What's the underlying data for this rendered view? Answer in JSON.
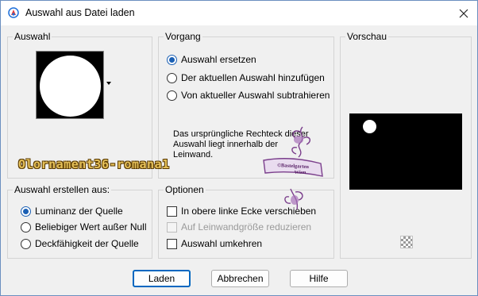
{
  "window": {
    "title": "Auswahl aus Datei laden"
  },
  "groups": {
    "auswahl": {
      "title": "Auswahl"
    },
    "vorgang": {
      "title": "Vorgang",
      "options": [
        {
          "label": "Auswahl ersetzen",
          "selected": true
        },
        {
          "label": "Der aktuellen Auswahl hinzufügen",
          "selected": false
        },
        {
          "label": "Von aktueller Auswahl subtrahieren",
          "selected": false
        }
      ],
      "info": "Das ursprüngliche Rechteck dieser Auswahl liegt innerhalb der Leinwand."
    },
    "vorschau": {
      "title": "Vorschau"
    },
    "erstellen": {
      "title": "Auswahl erstellen aus:",
      "options": [
        {
          "label": "Luminanz der Quelle",
          "selected": true
        },
        {
          "label": "Beliebiger Wert außer Null",
          "selected": false
        },
        {
          "label": "Deckfähigkeit der Quelle",
          "selected": false
        }
      ]
    },
    "optionen": {
      "title": "Optionen",
      "checks": [
        {
          "label": "In obere linke Ecke verschieben",
          "checked": false,
          "enabled": true
        },
        {
          "label": "Auf Leinwandgröße reduzieren",
          "checked": false,
          "enabled": false
        },
        {
          "label": "Auswahl umkehren",
          "checked": false,
          "enabled": true
        }
      ]
    }
  },
  "buttons": {
    "load": "Laden",
    "cancel": "Abbrechen",
    "help": "Hilfe"
  },
  "overlay": {
    "file_label": "Olornament36-romana1",
    "stamp_text": "©Bastelgarten Wien"
  },
  "colors": {
    "accent": "#0067c0",
    "stamp": "#7b3f8c",
    "watermark": "#e6c15a"
  }
}
